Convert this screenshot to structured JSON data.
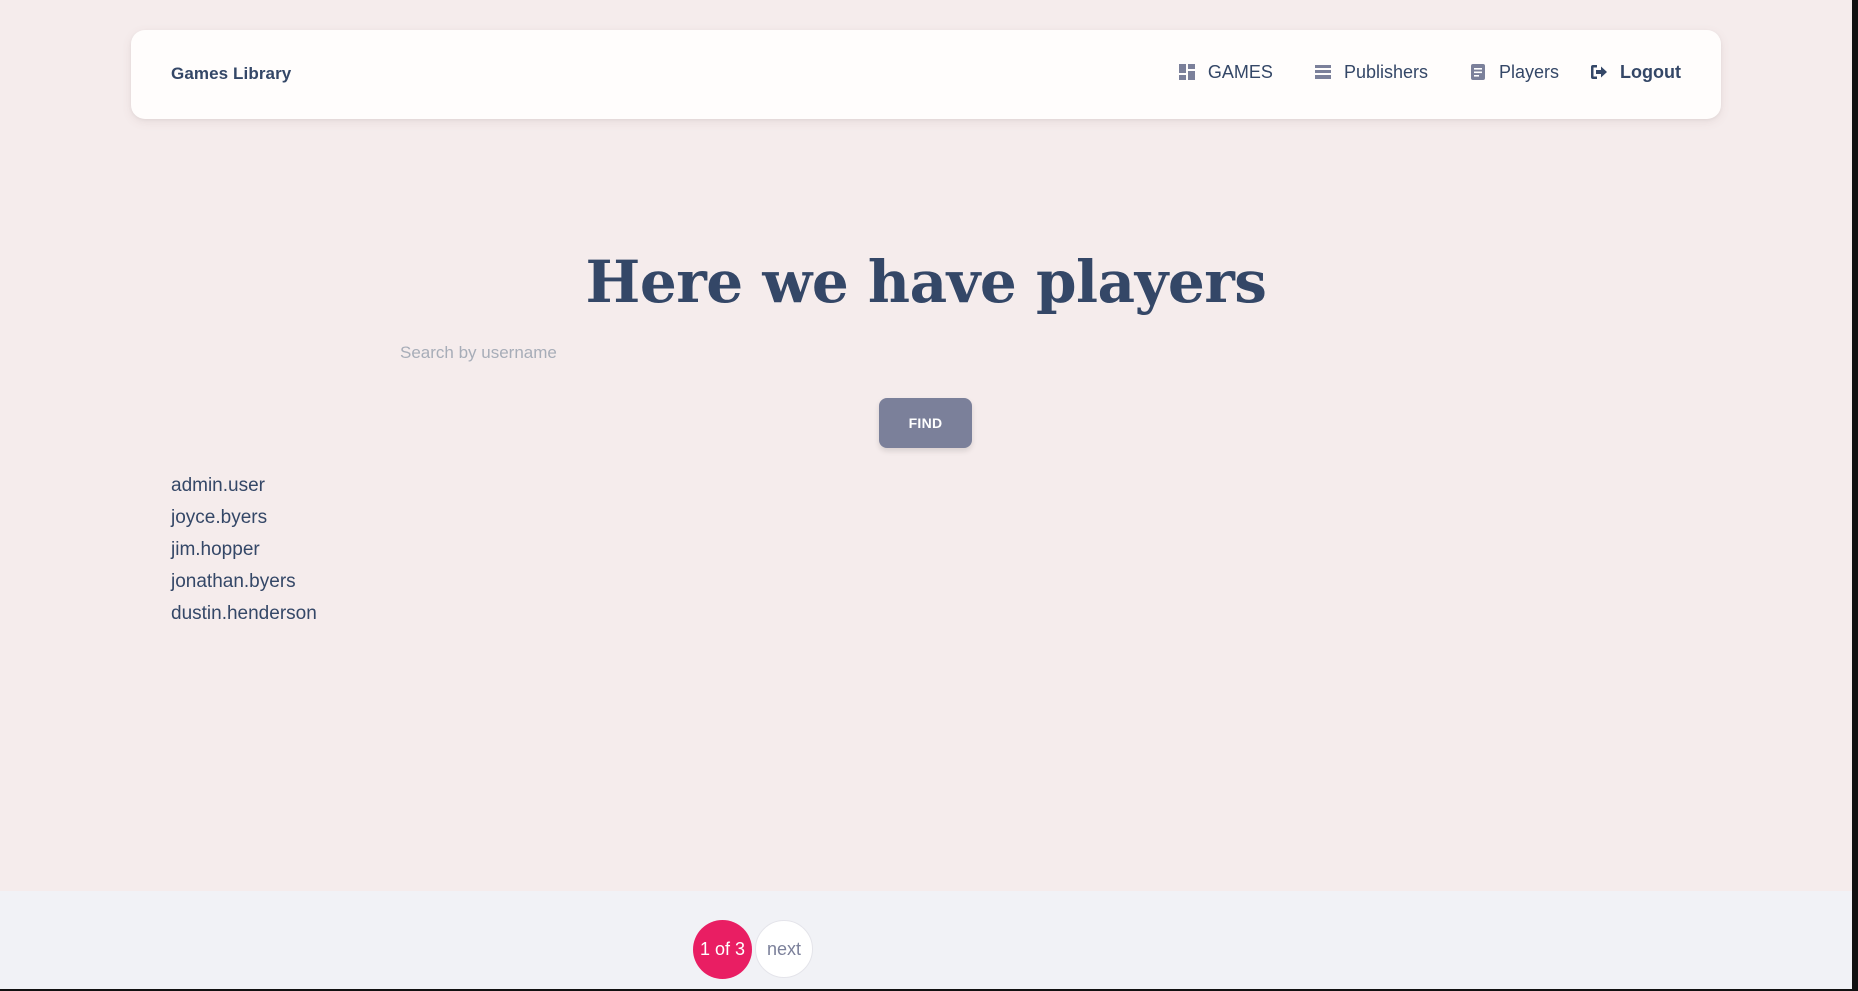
{
  "navbar": {
    "brand": "Games Library",
    "links": [
      {
        "label": "GAMES",
        "icon": "dashboard-icon"
      },
      {
        "label": "Publishers",
        "icon": "table-icon"
      },
      {
        "label": "Players",
        "icon": "document-icon"
      },
      {
        "label": "Logout",
        "icon": "logout-icon"
      }
    ]
  },
  "main": {
    "title": "Here we have players",
    "search": {
      "placeholder": "Search by username",
      "value": ""
    },
    "find_label": "FIND",
    "players": [
      "admin.user",
      "joyce.byers",
      "jim.hopper",
      "jonathan.byers",
      "dustin.henderson"
    ]
  },
  "pagination": {
    "current_label": "1 of 3",
    "next_label": "next"
  },
  "colors": {
    "background": "#f5ecec",
    "text": "#344767",
    "find_button": "#7b809a",
    "accent": "#e91e63",
    "footer": "#f1f2f6"
  }
}
